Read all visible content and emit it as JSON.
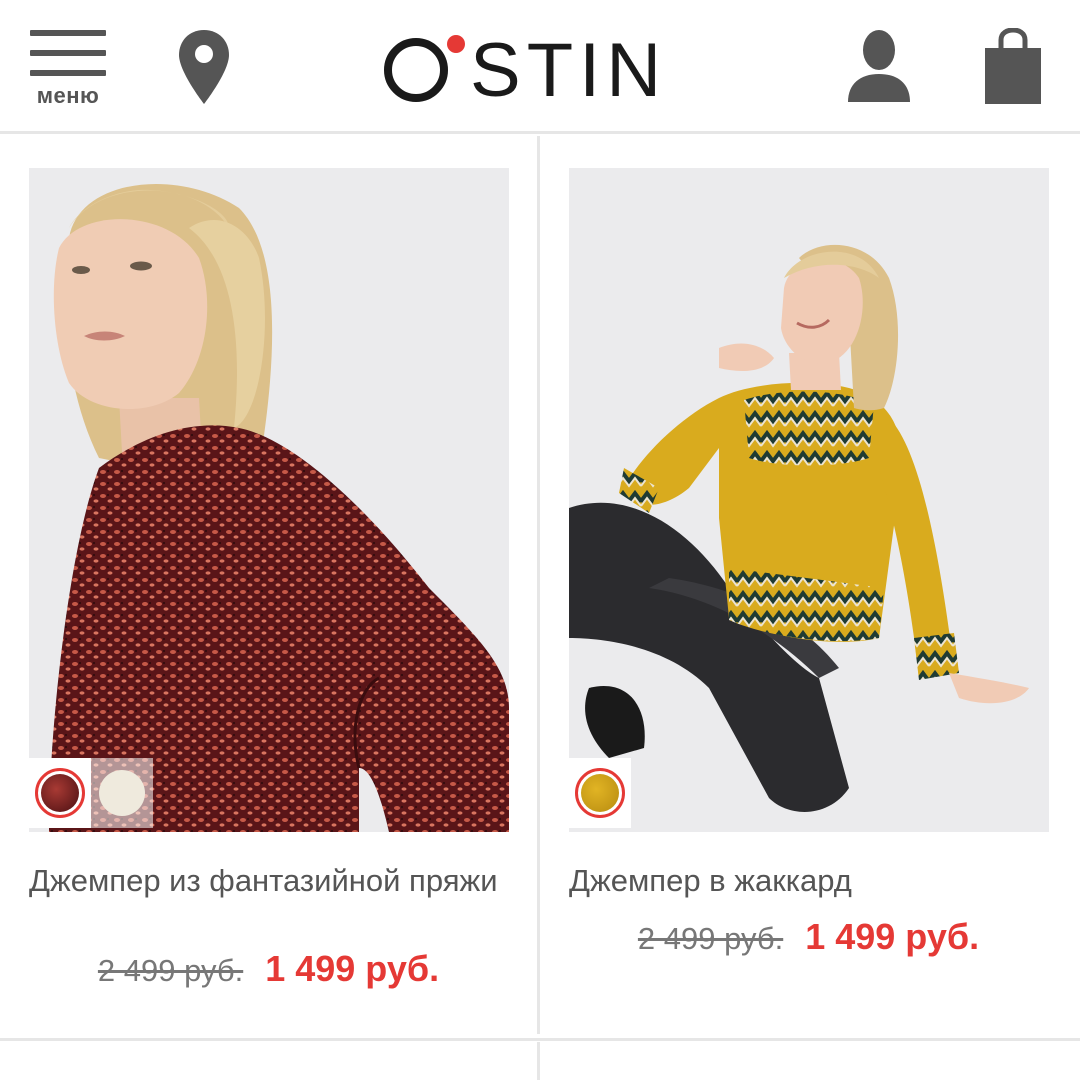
{
  "header": {
    "menu_label": "меню",
    "logo_text": "O STIN",
    "logo_full": "O'STIN",
    "icons": [
      "hamburger-menu-icon",
      "location-pin-icon",
      "user-icon",
      "shopping-bag-icon"
    ]
  },
  "colors": {
    "accent": "#e53935",
    "icon_gray": "#555555",
    "divider": "#e6e6e6",
    "photo_bg": "#ebebed"
  },
  "products": [
    {
      "title": "Джемпер из фантазийной пряжи",
      "old_price": "2 499 руб.",
      "new_price": "1 499 руб.",
      "swatches": [
        {
          "color": "#6b1e22",
          "selected": true
        },
        {
          "color": "#ece7d8",
          "selected": false
        }
      ]
    },
    {
      "title": "Джемпер в жаккард",
      "old_price": "2 499 руб.",
      "new_price": "1 499 руб.",
      "swatches": [
        {
          "color": "#d4a017",
          "selected": true
        }
      ]
    }
  ]
}
